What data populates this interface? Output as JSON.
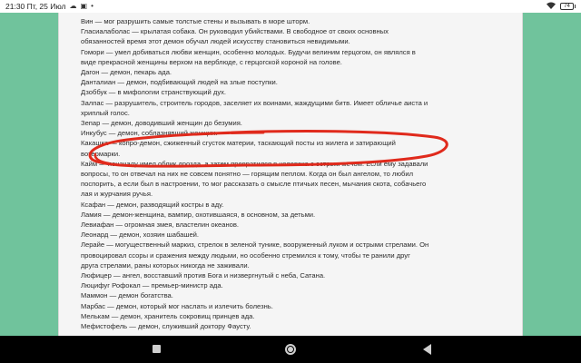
{
  "status_bar": {
    "time_date": "21:30 Пт, 25 Июл",
    "battery": "74"
  },
  "article": {
    "lines": [
      "Вин — мог разрушить самые толстые стены и вызывать в море шторм.",
      "Гласиалаболас — крылатая собака. Он руководил убийствами. В свободное от своих основных",
      "обязанностей время этот демон обучал людей искусству становиться невидимыми.",
      "Гомори — умел добиваться любви женщин, особенно молодых. Будучи велиним герцогом, он являлся в",
      "виде прекрасной женщины верхом на верблюде, с герцогской короной на голове.",
      "Дагон — демон, пекарь ада.",
      "Данталиан — демон, подбивающий людей на злые поступки.",
      "Дзоббук — в мифологии странствующий дух.",
      "Залпас — разрушитель, строитель городов, заселяет их воинами, жаждущими битв. Имеет обличье аиста и",
      "хриплый голос.",
      "Зепар — демон, доводивший женщин до безумия.",
      "Инкубус — демон, соблазнявший женщин.",
      "Какашка — копро-демон, сжиженный сгусток материи, таскающий посты из жилега и затирающий",
      "вотермарки.",
      "Кайм — поначалу имел облик дрозда, а затем превратился в человека с острым мечом. Если ему задавали",
      "вопросы, то он отвечал на них не совсем понятно — горящим пеплом. Когда он был ангелом, то любил",
      "поспорить, а если был в настроении, то мог рассказать о смысле птичьих песен, мычания скота, собачьего",
      "лая и журчания ручья.",
      "Ксафан — демон, разводящий костры в аду.",
      "Ламия — демон-женщина, вампир, охотившаяся, в основном, за детьми.",
      "Левиафан — огромная змея, властелин океанов.",
      "Леонард — демон, хозяин шабашей.",
      "Лерайе — могущественный маркиз, стрелок в зеленой тунике, вооруженный луком и острыми стрелами. Он",
      "провоцировал ссоры и сражения между людьми, но особенно стремился к тому, чтобы те ранили друг",
      "друга стрелами, раны которых никогда не заживали.",
      "Люфицер — ангел, восставший против Бога и низвергнутый с неба, Сатана.",
      "Люцифуг Рофокал — премьер-министр ада.",
      "Маммон — демон богатства.",
      "Марбас — демон, который мог наслать и излечить болезнь.",
      "Мелькам — демон, хранитель сокровищ принцев ада.",
      "Мефистофель — демон, служивший доктору Фаусту."
    ]
  },
  "colors": {
    "annotation": "#e02a1c",
    "page_bg": "#f5f5f5",
    "side_bg": "#70c39c",
    "navbar_bg": "#000000"
  },
  "icons": {
    "status_left": [
      "notification-cloud-icon",
      "notification-image-icon",
      "notification-dot-icon"
    ],
    "status_right": [
      "wifi-icon",
      "battery-icon"
    ],
    "nav": [
      "recent-apps-icon",
      "home-icon",
      "back-icon"
    ]
  }
}
